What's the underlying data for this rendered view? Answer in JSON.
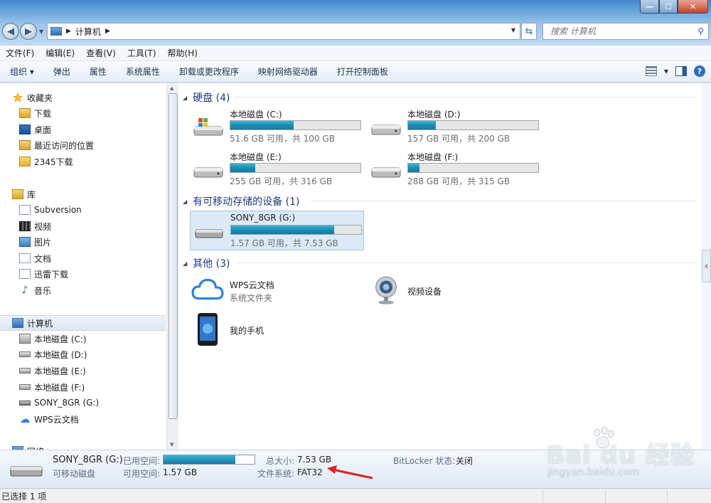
{
  "window": {
    "controls": {
      "minimize": "—",
      "maximize": "☐",
      "close": "✕"
    }
  },
  "address": {
    "path": "计算机",
    "search_placeholder": "搜索 计算机"
  },
  "menubar": [
    "文件(F)",
    "编辑(E)",
    "查看(V)",
    "工具(T)",
    "帮助(H)"
  ],
  "toolbar": {
    "items": [
      "组织 ▾",
      "弹出",
      "属性",
      "系统属性",
      "卸载或更改程序",
      "映射网络驱动器",
      "打开控制面板"
    ]
  },
  "sidebar": {
    "favorites": {
      "label": "收藏夹",
      "items": [
        "下载",
        "桌面",
        "最近访问的位置",
        "2345下载"
      ]
    },
    "libraries": {
      "label": "库",
      "items": [
        "Subversion",
        "视频",
        "图片",
        "文档",
        "迅雷下载",
        "音乐"
      ]
    },
    "computer": {
      "label": "计算机",
      "items": [
        "本地磁盘 (C:)",
        "本地磁盘 (D:)",
        "本地磁盘 (E:)",
        "本地磁盘 (F:)",
        "SONY_8GR (G:)",
        "WPS云文档"
      ]
    },
    "network": {
      "label": "网络"
    }
  },
  "groups": {
    "hard_disks": {
      "label": "硬盘 (4)"
    },
    "removable": {
      "label": "有可移动存储的设备 (1)"
    },
    "other": {
      "label": "其他 (3)"
    }
  },
  "drives": [
    {
      "name": "本地磁盘 (C:)",
      "free": "51.6 GB 可用，共 100 GB",
      "used_fraction": 0.484
    },
    {
      "name": "本地磁盘 (D:)",
      "free": "157 GB 可用，共 200 GB",
      "used_fraction": 0.215
    },
    {
      "name": "本地磁盘 (E:)",
      "free": "255 GB 可用，共 316 GB",
      "used_fraction": 0.193
    },
    {
      "name": "本地磁盘 (F:)",
      "free": "288 GB 可用，共 315 GB",
      "used_fraction": 0.086
    },
    {
      "name": "SONY_8GR (G:)",
      "free": "1.57 GB 可用，共 7.53 GB",
      "used_fraction": 0.79
    }
  ],
  "others": [
    {
      "name": "WPS云文档",
      "type": "系统文件夹"
    },
    {
      "name": "视频设备",
      "type": ""
    },
    {
      "name": "我的手机",
      "type": ""
    }
  ],
  "details": {
    "name": "SONY_8GR (G:)",
    "type": "可移动磁盘",
    "used_label": "已用空间:",
    "used_fraction": 0.79,
    "free_label": "可用空间:",
    "free_value": "1.57 GB",
    "total_label": "总大小:",
    "total_value": "7.53 GB",
    "fs_label": "文件系统:",
    "fs_value": "FAT32",
    "bitlocker_label": "BitLocker 状态:",
    "bitlocker_value": "关闭"
  },
  "status": {
    "text": "已选择 1 项"
  },
  "watermark": {
    "brand": "Bai du 经验",
    "url": "jingyan.baidu.com"
  },
  "colors": {
    "accent": "#1c8cb2",
    "annotation": "#e02020"
  }
}
